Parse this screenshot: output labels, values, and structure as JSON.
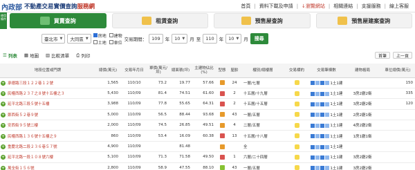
{
  "brand": {
    "logo": "內政部",
    "title": "不動產交易實價查詢",
    "accent": "服務網"
  },
  "topnav": [
    "首頁",
    "資料下載及申請",
    "↓瀏覽網站",
    "相關連結",
    "支援服務",
    "線上客服"
  ],
  "sidebar": {
    "label": "使用條件"
  },
  "tabs": [
    {
      "label": "買賣查詢",
      "active": true
    },
    {
      "label": "租賃查詢",
      "active": false
    },
    {
      "label": "預售屋查詢",
      "active": false
    },
    {
      "label": "預售屋建案查詢",
      "active": false
    }
  ],
  "filters": {
    "city": "臺北市",
    "district": "大同區",
    "types_top": [
      "房地",
      "建物"
    ],
    "types_bottom": [
      "土地",
      "車位"
    ],
    "period_label": "交易期間：",
    "from_year": "109",
    "from_month": "10",
    "to_label": "至",
    "to_year": "110",
    "to_month": "10",
    "year_unit": "年",
    "month_unit": "月",
    "query_label": "搜尋"
  },
  "views": {
    "list": "列表",
    "map": "地圖",
    "compare": "比較清單",
    "print": "列印"
  },
  "pager": {
    "first": "首筆",
    "prev": "上一頁"
  },
  "table": {
    "headers": [
      "地段位置或門牌",
      "總價(萬元)",
      "交易年月日",
      "單價(萬元/坪)",
      "總面積(坪)",
      "主建物佔比(%)",
      "型態",
      "屋齡",
      "樓別/總樓層",
      "交易標的",
      "交易筆棟數",
      "建物格局",
      "車位總價(萬元)"
    ],
    "rows": [
      {
        "addr": "承德路三段１２２巷１２號",
        "price": "1,565",
        "date": "110/10",
        "unit": "73.2",
        "area": "19.77",
        "main": "57.66",
        "type": "orange",
        "age": "24",
        "floor": "一層/七層",
        "deal": "1土1建",
        "layout": "",
        "park": "150"
      },
      {
        "addr": "民權西路２３７之８號十五樓之３",
        "price": "5,430",
        "date": "110/09",
        "unit": "81.4",
        "area": "74.51",
        "main": "61.60",
        "type": "red",
        "age": "2",
        "floor": "十五層/十九層",
        "deal": "1土1建",
        "layout": "3房2廳2衛",
        "park": "335"
      },
      {
        "addr": "延平北路三段５號十五樓",
        "price": "3,988",
        "date": "110/09",
        "unit": "77.8",
        "area": "55.65",
        "main": "64.31",
        "type": "red",
        "age": "2",
        "floor": "十五層/十五層",
        "deal": "1土1建",
        "layout": "3房2廳2衛",
        "park": "120"
      },
      {
        "addr": "鄭西街５２巷９號",
        "price": "5,000",
        "date": "110/09",
        "unit": "56.5",
        "area": "88.44",
        "main": "93.68",
        "type": "orange",
        "age": "43",
        "floor": "一層/五層",
        "deal": "1土1建",
        "layout": "2房2廳1衛",
        "park": ""
      },
      {
        "addr": "安西街９５號二樓",
        "price": "2,000",
        "date": "110/09",
        "unit": "74.5",
        "area": "26.85",
        "main": "49.51",
        "type": "orange",
        "age": "4",
        "floor": "二層/五層",
        "deal": "1土1建",
        "layout": "4房2廳2衛",
        "park": ""
      },
      {
        "addr": "民權西路１３６號十五樓之９",
        "price": "860",
        "date": "110/09",
        "unit": "53.4",
        "area": "16.09",
        "main": "60.38",
        "type": "red",
        "age": "13",
        "floor": "十五層/十八層",
        "deal": "1土1建",
        "layout": "1房1廳1衛",
        "park": ""
      },
      {
        "addr": "重慶北路二段２３６巷５７號",
        "price": "4,900",
        "date": "110/09",
        "unit": "",
        "area": "81.48",
        "main": "",
        "type": "orange",
        "age": "",
        "floor": "全",
        "deal": "1土1建",
        "layout": "",
        "park": ""
      },
      {
        "addr": "延平北路一段１０８號六樓",
        "price": "5,100",
        "date": "110/09",
        "unit": "71.3",
        "area": "71.58",
        "main": "49.50",
        "type": "red",
        "age": "1",
        "floor": "六層/二十四層",
        "deal": "1土1建",
        "layout": "3房2廳2衛",
        "park": ""
      },
      {
        "addr": "萬全街１５６號",
        "price": "2,800",
        "date": "110/09",
        "unit": "58.9",
        "area": "47.55",
        "main": "88.10",
        "type": "green",
        "age": "43",
        "floor": "一層/五層",
        "deal": "1土1建",
        "layout": "3房2廳2衛",
        "park": ""
      }
    ]
  }
}
